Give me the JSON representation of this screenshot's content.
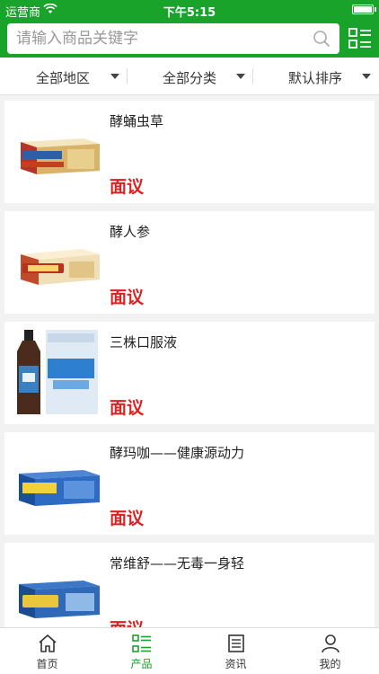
{
  "status_bar": {
    "carrier": "运营商",
    "time": "下午5:15"
  },
  "search": {
    "placeholder": "请输入商品关键字"
  },
  "filters": [
    {
      "label": "全部地区"
    },
    {
      "label": "全部分类"
    },
    {
      "label": "默认排序"
    }
  ],
  "products": [
    {
      "name": "酵蛹虫草",
      "price": "面议"
    },
    {
      "name": "酵人参",
      "price": "面议"
    },
    {
      "name": "三株口服液",
      "price": "面议"
    },
    {
      "name": "酵玛咖——健康源动力",
      "price": "面议"
    },
    {
      "name": "常维舒——无毒一身轻",
      "price": "面议"
    }
  ],
  "tabs": [
    {
      "label": "首页",
      "icon": "home-icon"
    },
    {
      "label": "产品",
      "icon": "product-grid-icon"
    },
    {
      "label": "资讯",
      "icon": "news-icon"
    },
    {
      "label": "我的",
      "icon": "user-icon"
    }
  ],
  "colors": {
    "brand": "#1aa32a",
    "price": "#e02020"
  }
}
